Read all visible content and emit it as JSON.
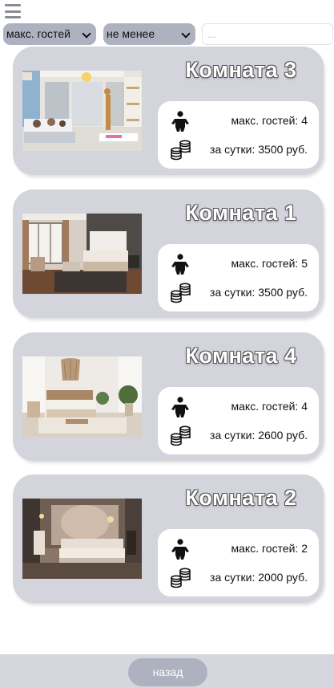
{
  "filters": {
    "guests_select": "макс. гостей",
    "condition_select": "не менее",
    "value_input_placeholder": "..."
  },
  "rooms": [
    {
      "title": "Комната 3",
      "guests": "макс. гостей: 4",
      "price": "за сутки: 3500 руб.",
      "photo": "bright-room-with-kids"
    },
    {
      "title": "Комната 1",
      "guests": "макс. гостей: 5",
      "price": "за сутки: 3500 руб.",
      "photo": "modern-bedroom-dark-wall"
    },
    {
      "title": "Комната 4",
      "guests": "макс. гостей: 4",
      "price": "за сутки: 2600 руб.",
      "photo": "boho-bedroom-white"
    },
    {
      "title": "Комната 2",
      "guests": "макс. гостей: 2",
      "price": "за сутки: 2000 руб.",
      "photo": "warm-bedroom-evening"
    }
  ],
  "icons": {
    "menu": "hamburger-icon",
    "guests": "person-icon",
    "price": "coins-icon"
  },
  "footer": {
    "back_label": "назад"
  },
  "colors": {
    "card_bg": "#d3d4dc",
    "control_bg": "#aeb1c0",
    "footer_bg": "#d6d7de"
  }
}
